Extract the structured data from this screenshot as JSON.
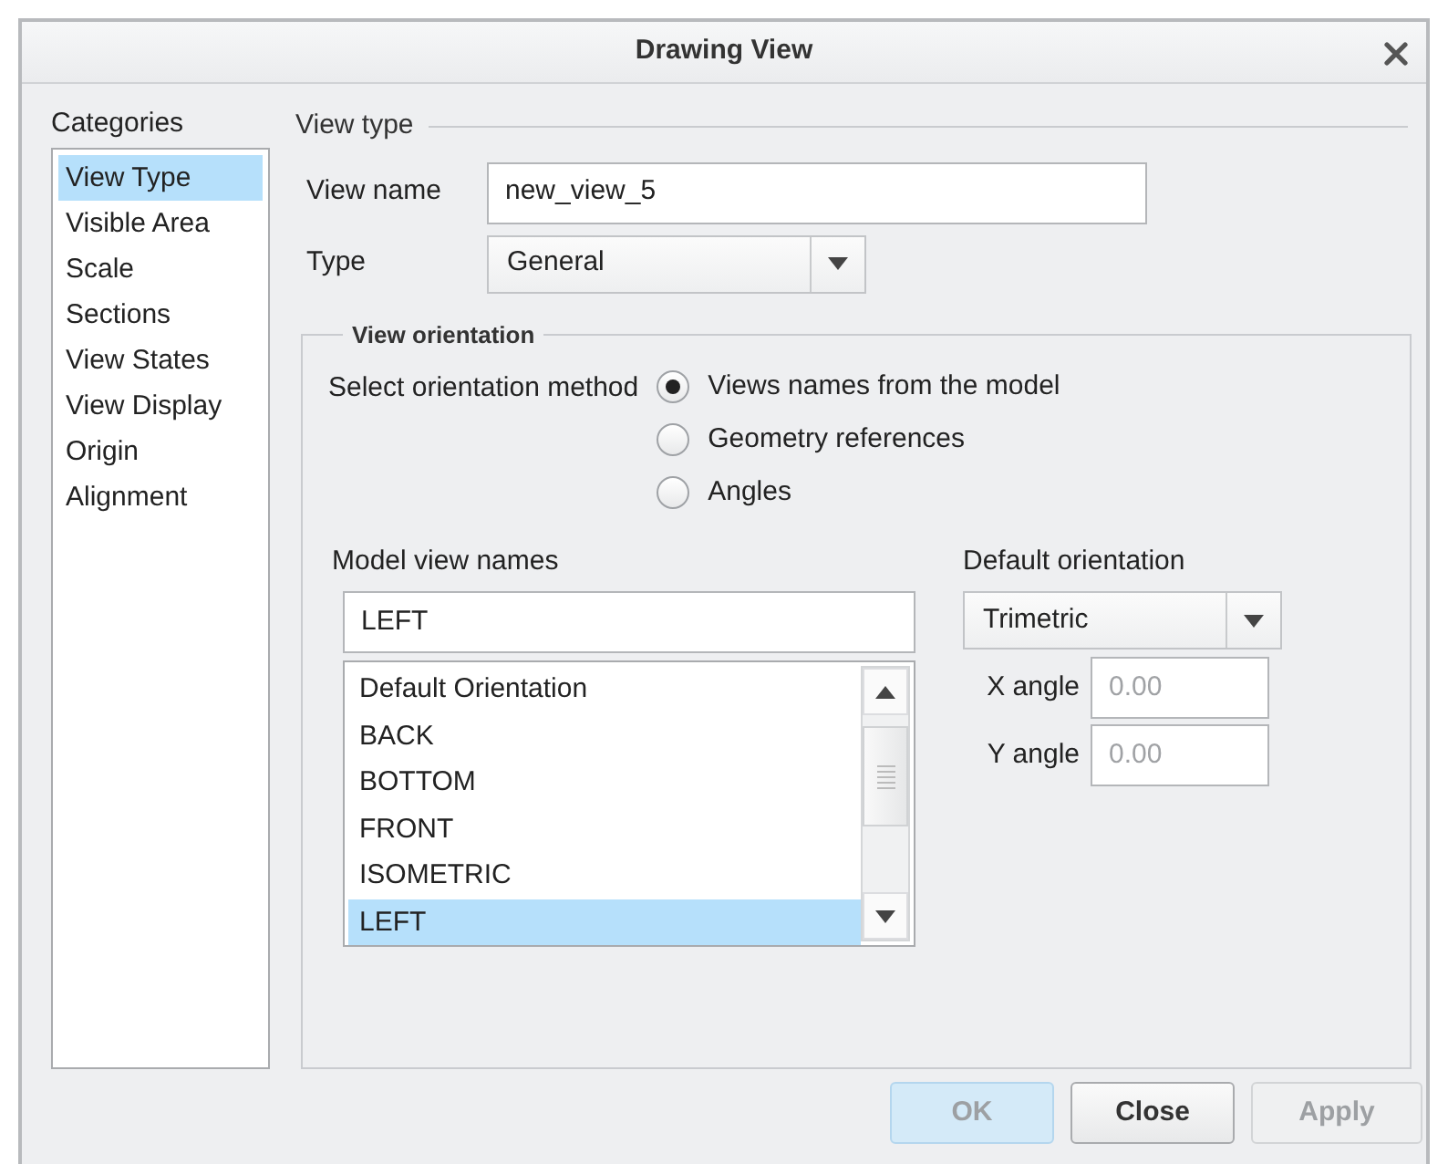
{
  "window": {
    "title": "Drawing View"
  },
  "categories": {
    "title": "Categories",
    "items": [
      {
        "label": "View Type",
        "selected": true
      },
      {
        "label": "Visible Area",
        "selected": false
      },
      {
        "label": "Scale",
        "selected": false
      },
      {
        "label": "Sections",
        "selected": false
      },
      {
        "label": "View States",
        "selected": false
      },
      {
        "label": "View Display",
        "selected": false
      },
      {
        "label": "Origin",
        "selected": false
      },
      {
        "label": "Alignment",
        "selected": false
      }
    ]
  },
  "view_type": {
    "title": "View type",
    "view_name": {
      "label": "View name",
      "value": "new_view_5"
    },
    "type": {
      "label": "Type",
      "value": "General"
    }
  },
  "view_orientation": {
    "title": "View orientation",
    "method_label": "Select orientation method",
    "options": [
      {
        "label": "Views names from the model",
        "selected": true
      },
      {
        "label": "Geometry references",
        "selected": false
      },
      {
        "label": "Angles",
        "selected": false
      }
    ],
    "model_view_names": {
      "label": "Model view names",
      "value": "LEFT",
      "items": [
        {
          "label": "Default Orientation",
          "selected": false
        },
        {
          "label": "BACK",
          "selected": false
        },
        {
          "label": "BOTTOM",
          "selected": false
        },
        {
          "label": "FRONT",
          "selected": false
        },
        {
          "label": "ISOMETRIC",
          "selected": false
        },
        {
          "label": "LEFT",
          "selected": true
        }
      ]
    },
    "default_orientation": {
      "label": "Default orientation",
      "value": "Trimetric"
    },
    "angles": [
      {
        "label": "X angle",
        "value": "0.00",
        "disabled": true
      },
      {
        "label": "Y angle",
        "value": "0.00",
        "disabled": true
      }
    ]
  },
  "buttons": [
    {
      "label": "OK",
      "disabled": true
    },
    {
      "label": "Close",
      "disabled": false
    },
    {
      "label": "Apply",
      "disabled": true
    }
  ]
}
